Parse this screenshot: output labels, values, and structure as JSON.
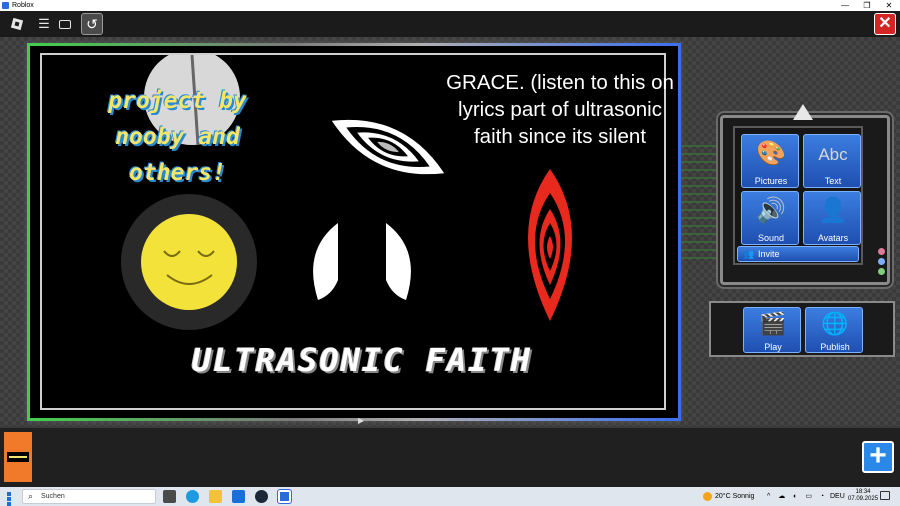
{
  "window": {
    "title": "Roblox",
    "controls": [
      "—",
      "❐",
      "✕"
    ]
  },
  "topbar": {
    "menu_icon": "☰",
    "undo_icon": "↺",
    "close_icon": "✕"
  },
  "canvas": {
    "credit_lines": [
      "project by",
      "nooby and",
      "others!"
    ],
    "grace_text": "GRACE. (listen to this on lyrics part of ultrasonic faith since its silent",
    "title": "ULTRASONIC FAITH"
  },
  "tools": {
    "pictures_label": "Pictures",
    "text_label": "Text",
    "sound_label": "Sound",
    "avatars_label": "Avatars",
    "invite_label": "Invite",
    "text_icon": "Abc"
  },
  "actions": {
    "play_label": "Play",
    "publish_label": "Publish"
  },
  "bottom": {
    "add_icon": "+"
  },
  "taskbar": {
    "search_placeholder": "Suchen",
    "temperature": "20°C",
    "weather": "Sonnig",
    "language": "DEU",
    "time": "18:34",
    "date": "07.09.2025"
  },
  "colors": {
    "accent_blue": "#2a88e8",
    "close_red": "#d42525",
    "credit_yellow": "#f4e56b"
  }
}
